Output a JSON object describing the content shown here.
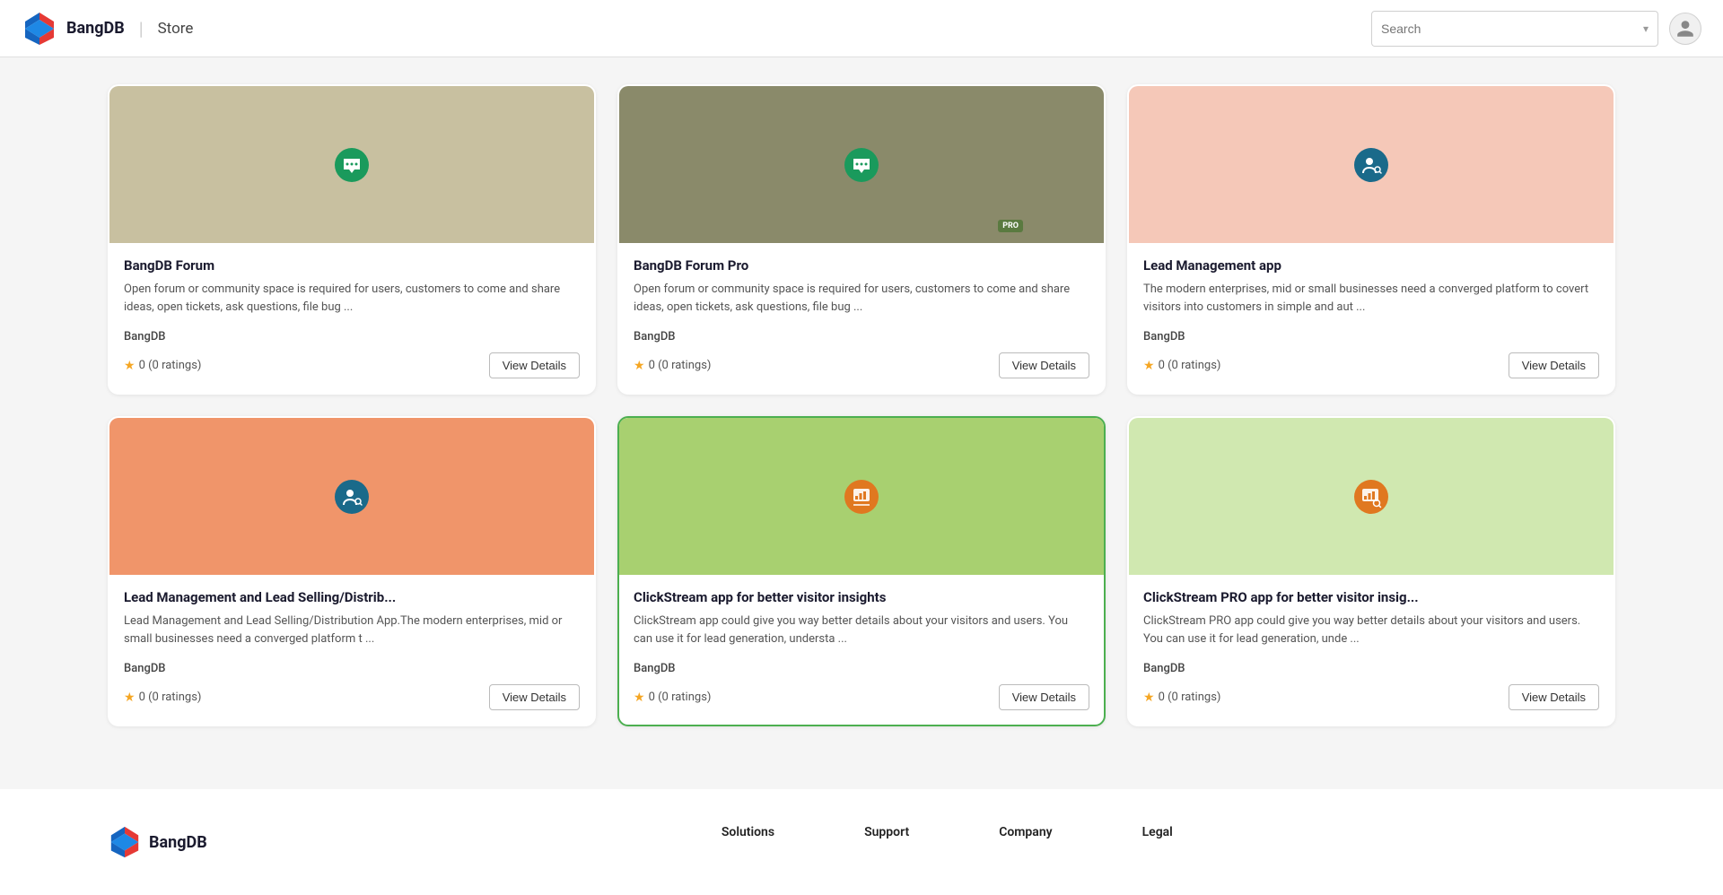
{
  "header": {
    "brand": "BangDB",
    "separator": "|",
    "store": "Store",
    "search_placeholder": "Search"
  },
  "cards": [
    {
      "id": "bangdb-forum",
      "title": "BangDB Forum",
      "description": "Open forum or community space is required for users, customers to come and share ideas, open tickets, ask questions, file bug ...",
      "description_link_text": "community space",
      "author": "BangDB",
      "rating": "0",
      "rating_count": "0 ratings",
      "button_label": "View Details",
      "bg_class": "bg-tan",
      "icon_bg": "#1a9a5c",
      "icon": "chat",
      "highlighted": false,
      "pro": false
    },
    {
      "id": "bangdb-forum-pro",
      "title": "BangDB Forum Pro",
      "description": "Open forum or community space is required for users, customers to come and share ideas, open tickets, ask questions, file bug ...",
      "description_link_text": "community space",
      "author": "BangDB",
      "rating": "0",
      "rating_count": "0 ratings",
      "button_label": "View Details",
      "bg_class": "bg-dark-tan",
      "icon_bg": "#1a9a5c",
      "icon": "chat",
      "highlighted": false,
      "pro": true
    },
    {
      "id": "lead-management",
      "title": "Lead Management app",
      "description": "The modern enterprises, mid or small businesses need a converged platform to covert visitors into customers in simple and aut ...",
      "author": "BangDB",
      "rating": "0",
      "rating_count": "0 ratings",
      "button_label": "View Details",
      "bg_class": "bg-peach",
      "icon_bg": "#1a6a8a",
      "icon": "person-search",
      "highlighted": false,
      "pro": false
    },
    {
      "id": "lead-management-selling",
      "title": "Lead Management and Lead Selling/Distrib...",
      "description": "Lead Management and Lead Selling/Distribution App.The modern enterprises, mid or small businesses need a converged platform t ...",
      "author": "BangDB",
      "rating": "0",
      "rating_count": "0 ratings",
      "button_label": "View Details",
      "bg_class": "bg-salmon",
      "icon_bg": "#1a6a8a",
      "icon": "person-search",
      "highlighted": false,
      "pro": false
    },
    {
      "id": "clickstream",
      "title": "ClickStream app for better visitor insights",
      "description": "ClickStream app could give you way better details about your visitors and users. You can use it for lead generation, understa ...",
      "author": "BangDB",
      "rating": "0",
      "rating_count": "0 ratings",
      "button_label": "View Details",
      "bg_class": "bg-green",
      "icon_bg": "#e07820",
      "icon": "chart",
      "highlighted": true,
      "pro": false
    },
    {
      "id": "clickstream-pro",
      "title": "ClickStream PRO app for better visitor insig...",
      "description": "ClickStream PRO app could give you way better details about your visitors and users. You can use it for lead generation, unde ...",
      "author": "BangDB",
      "rating": "0",
      "rating_count": "0 ratings",
      "button_label": "View Details",
      "bg_class": "bg-light-green",
      "icon_bg": "#e07820",
      "icon": "chart-search",
      "highlighted": false,
      "pro": false
    }
  ],
  "footer": {
    "brand": "BangDB",
    "columns": [
      {
        "label": "Solutions"
      },
      {
        "label": "Support"
      },
      {
        "label": "Company"
      },
      {
        "label": "Legal"
      }
    ]
  }
}
